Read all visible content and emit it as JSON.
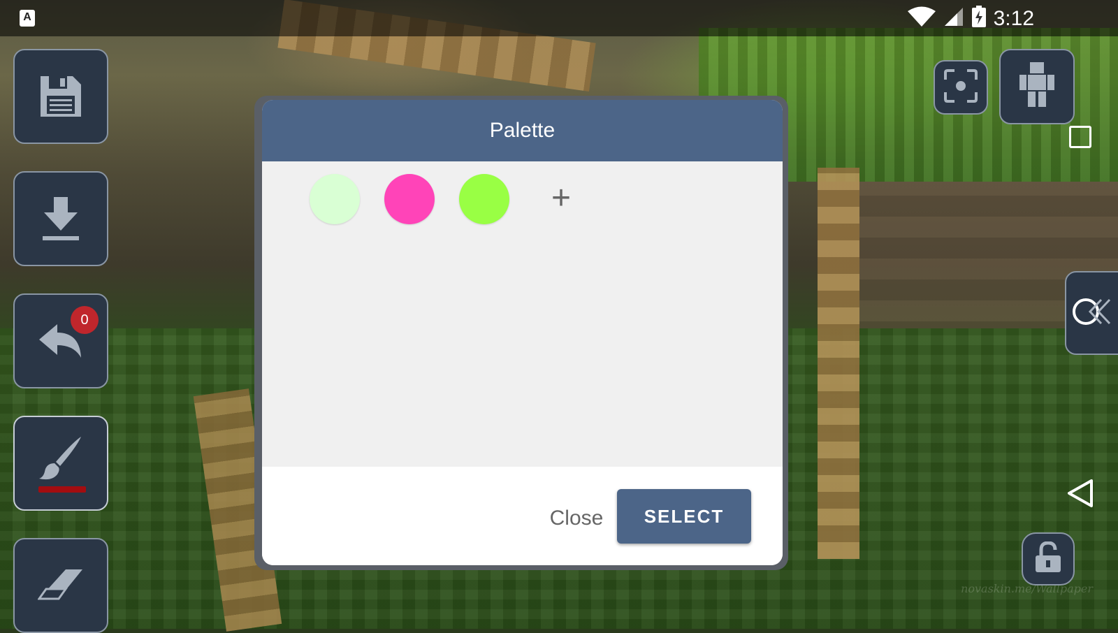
{
  "status_bar": {
    "app_icon_letter": "A",
    "time": "3:12"
  },
  "left_toolbar": {
    "tools": [
      {
        "name": "save",
        "icon": "floppy-disk-icon"
      },
      {
        "name": "download",
        "icon": "download-icon"
      },
      {
        "name": "undo",
        "icon": "undo-icon",
        "badge": "0"
      },
      {
        "name": "brush",
        "icon": "brush-icon",
        "color": "#a30d10"
      },
      {
        "name": "eraser",
        "icon": "eraser-icon"
      }
    ]
  },
  "right_controls": {
    "icons": [
      "focus-icon",
      "skin-model-icon",
      "recent-apps-square-icon",
      "collapse-panel-icon",
      "back-triangle-icon",
      "lock-icon"
    ]
  },
  "dialog": {
    "title": "Palette",
    "swatches": [
      "#d9ffd4",
      "#ff44b8",
      "#99ff44"
    ],
    "add_symbol": "+",
    "close_label": "Close",
    "select_label": "SELECT"
  },
  "watermark": "novaskin.me/Wallpaper",
  "colors": {
    "header": "#4c6588",
    "toolbar_bg": "#2a3646",
    "badge": "#c0262c"
  }
}
